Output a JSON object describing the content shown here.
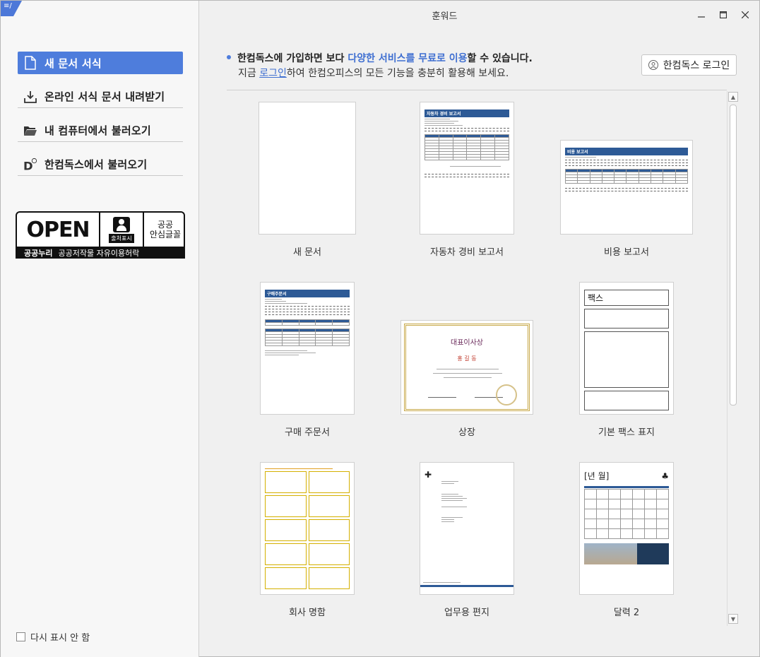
{
  "window": {
    "title": "훈워드",
    "minimize": "—",
    "maximize": "☐",
    "close": "✕"
  },
  "sidebar": {
    "items": [
      {
        "label": "새 문서 서식",
        "icon": "new-document-icon"
      },
      {
        "label": "온라인 서식 문서 내려받기",
        "icon": "download-icon"
      },
      {
        "label": "내 컴퓨터에서 불러오기",
        "icon": "folder-icon"
      },
      {
        "label": "한컴독스에서 불러오기",
        "icon": "hancomdocs-icon"
      }
    ],
    "badge": {
      "open": "OPEN",
      "credit": "출처표시",
      "safe_line1": "공공",
      "safe_line2": "안심글꼴",
      "bottom_bold": "공공누리",
      "bottom_text": "공공저작물 자유이용허락"
    },
    "dont_show": "다시 표시 안 함"
  },
  "notice": {
    "line1_a": "한컴독스에 가입하면 보다 ",
    "line1_hl": "다양한 서비스를 무료로 이용",
    "line1_b": "할 수 있습니다.",
    "line2_a": "지금 ",
    "line2_link": "로그인",
    "line2_b": "하여 한컴오피스의 모든 기능을 충분히 활용해 보세요."
  },
  "login_button": "한컴독스 로그인",
  "templates": [
    {
      "label": "새 문서"
    },
    {
      "label": "자동차 경비 보고서",
      "thumb_title": "자동차 경비 보고서"
    },
    {
      "label": "비용 보고서",
      "thumb_title": "비용 보고서"
    },
    {
      "label": "구매 주문서",
      "thumb_title": "구매주문서"
    },
    {
      "label": "상장",
      "thumb_title": "대표이사상",
      "thumb_name": "홍 길 동"
    },
    {
      "label": "기본 팩스 표지",
      "thumb_title": "팩스"
    },
    {
      "label": "회사 명함"
    },
    {
      "label": "업무용 편지"
    },
    {
      "label": "달력 2",
      "thumb_title": "[년 월]"
    }
  ],
  "colors": {
    "accent": "#4e7ddc",
    "link": "#3f6fd1",
    "doc_blue": "#2d5a96"
  }
}
